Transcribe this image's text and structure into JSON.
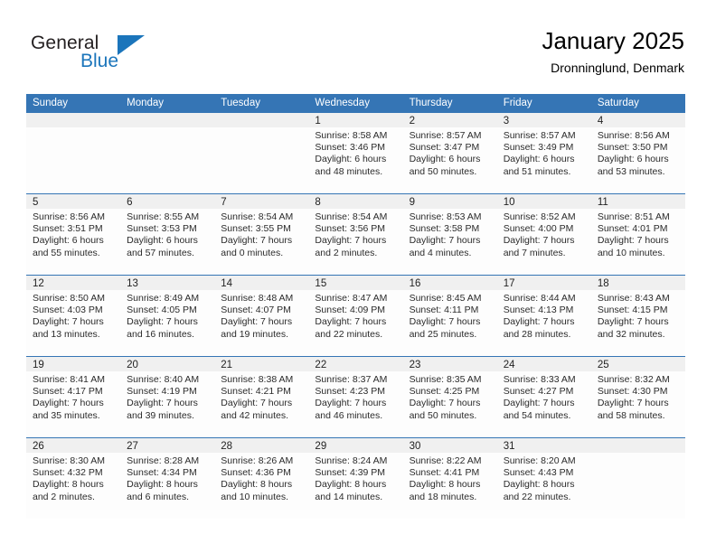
{
  "brand": {
    "name_part1": "General",
    "name_part2": "Blue",
    "flag_icon": "triangle-flag-icon",
    "accent_color": "#1b75bb"
  },
  "header": {
    "title": "January 2025",
    "location": "Dronninglund, Denmark"
  },
  "theme": {
    "header_blue": "#3575b5",
    "daynum_band": "#f0f0f0",
    "page_background": "#ffffff"
  },
  "weekday_headers": [
    "Sunday",
    "Monday",
    "Tuesday",
    "Wednesday",
    "Thursday",
    "Friday",
    "Saturday"
  ],
  "weeks": [
    [
      {
        "day": "",
        "sunrise": "",
        "sunset": "",
        "daylight_line1": "",
        "daylight_line2": ""
      },
      {
        "day": "",
        "sunrise": "",
        "sunset": "",
        "daylight_line1": "",
        "daylight_line2": ""
      },
      {
        "day": "",
        "sunrise": "",
        "sunset": "",
        "daylight_line1": "",
        "daylight_line2": ""
      },
      {
        "day": "1",
        "sunrise": "Sunrise: 8:58 AM",
        "sunset": "Sunset: 3:46 PM",
        "daylight_line1": "Daylight: 6 hours",
        "daylight_line2": "and 48 minutes."
      },
      {
        "day": "2",
        "sunrise": "Sunrise: 8:57 AM",
        "sunset": "Sunset: 3:47 PM",
        "daylight_line1": "Daylight: 6 hours",
        "daylight_line2": "and 50 minutes."
      },
      {
        "day": "3",
        "sunrise": "Sunrise: 8:57 AM",
        "sunset": "Sunset: 3:49 PM",
        "daylight_line1": "Daylight: 6 hours",
        "daylight_line2": "and 51 minutes."
      },
      {
        "day": "4",
        "sunrise": "Sunrise: 8:56 AM",
        "sunset": "Sunset: 3:50 PM",
        "daylight_line1": "Daylight: 6 hours",
        "daylight_line2": "and 53 minutes."
      }
    ],
    [
      {
        "day": "5",
        "sunrise": "Sunrise: 8:56 AM",
        "sunset": "Sunset: 3:51 PM",
        "daylight_line1": "Daylight: 6 hours",
        "daylight_line2": "and 55 minutes."
      },
      {
        "day": "6",
        "sunrise": "Sunrise: 8:55 AM",
        "sunset": "Sunset: 3:53 PM",
        "daylight_line1": "Daylight: 6 hours",
        "daylight_line2": "and 57 minutes."
      },
      {
        "day": "7",
        "sunrise": "Sunrise: 8:54 AM",
        "sunset": "Sunset: 3:55 PM",
        "daylight_line1": "Daylight: 7 hours",
        "daylight_line2": "and 0 minutes."
      },
      {
        "day": "8",
        "sunrise": "Sunrise: 8:54 AM",
        "sunset": "Sunset: 3:56 PM",
        "daylight_line1": "Daylight: 7 hours",
        "daylight_line2": "and 2 minutes."
      },
      {
        "day": "9",
        "sunrise": "Sunrise: 8:53 AM",
        "sunset": "Sunset: 3:58 PM",
        "daylight_line1": "Daylight: 7 hours",
        "daylight_line2": "and 4 minutes."
      },
      {
        "day": "10",
        "sunrise": "Sunrise: 8:52 AM",
        "sunset": "Sunset: 4:00 PM",
        "daylight_line1": "Daylight: 7 hours",
        "daylight_line2": "and 7 minutes."
      },
      {
        "day": "11",
        "sunrise": "Sunrise: 8:51 AM",
        "sunset": "Sunset: 4:01 PM",
        "daylight_line1": "Daylight: 7 hours",
        "daylight_line2": "and 10 minutes."
      }
    ],
    [
      {
        "day": "12",
        "sunrise": "Sunrise: 8:50 AM",
        "sunset": "Sunset: 4:03 PM",
        "daylight_line1": "Daylight: 7 hours",
        "daylight_line2": "and 13 minutes."
      },
      {
        "day": "13",
        "sunrise": "Sunrise: 8:49 AM",
        "sunset": "Sunset: 4:05 PM",
        "daylight_line1": "Daylight: 7 hours",
        "daylight_line2": "and 16 minutes."
      },
      {
        "day": "14",
        "sunrise": "Sunrise: 8:48 AM",
        "sunset": "Sunset: 4:07 PM",
        "daylight_line1": "Daylight: 7 hours",
        "daylight_line2": "and 19 minutes."
      },
      {
        "day": "15",
        "sunrise": "Sunrise: 8:47 AM",
        "sunset": "Sunset: 4:09 PM",
        "daylight_line1": "Daylight: 7 hours",
        "daylight_line2": "and 22 minutes."
      },
      {
        "day": "16",
        "sunrise": "Sunrise: 8:45 AM",
        "sunset": "Sunset: 4:11 PM",
        "daylight_line1": "Daylight: 7 hours",
        "daylight_line2": "and 25 minutes."
      },
      {
        "day": "17",
        "sunrise": "Sunrise: 8:44 AM",
        "sunset": "Sunset: 4:13 PM",
        "daylight_line1": "Daylight: 7 hours",
        "daylight_line2": "and 28 minutes."
      },
      {
        "day": "18",
        "sunrise": "Sunrise: 8:43 AM",
        "sunset": "Sunset: 4:15 PM",
        "daylight_line1": "Daylight: 7 hours",
        "daylight_line2": "and 32 minutes."
      }
    ],
    [
      {
        "day": "19",
        "sunrise": "Sunrise: 8:41 AM",
        "sunset": "Sunset: 4:17 PM",
        "daylight_line1": "Daylight: 7 hours",
        "daylight_line2": "and 35 minutes."
      },
      {
        "day": "20",
        "sunrise": "Sunrise: 8:40 AM",
        "sunset": "Sunset: 4:19 PM",
        "daylight_line1": "Daylight: 7 hours",
        "daylight_line2": "and 39 minutes."
      },
      {
        "day": "21",
        "sunrise": "Sunrise: 8:38 AM",
        "sunset": "Sunset: 4:21 PM",
        "daylight_line1": "Daylight: 7 hours",
        "daylight_line2": "and 42 minutes."
      },
      {
        "day": "22",
        "sunrise": "Sunrise: 8:37 AM",
        "sunset": "Sunset: 4:23 PM",
        "daylight_line1": "Daylight: 7 hours",
        "daylight_line2": "and 46 minutes."
      },
      {
        "day": "23",
        "sunrise": "Sunrise: 8:35 AM",
        "sunset": "Sunset: 4:25 PM",
        "daylight_line1": "Daylight: 7 hours",
        "daylight_line2": "and 50 minutes."
      },
      {
        "day": "24",
        "sunrise": "Sunrise: 8:33 AM",
        "sunset": "Sunset: 4:27 PM",
        "daylight_line1": "Daylight: 7 hours",
        "daylight_line2": "and 54 minutes."
      },
      {
        "day": "25",
        "sunrise": "Sunrise: 8:32 AM",
        "sunset": "Sunset: 4:30 PM",
        "daylight_line1": "Daylight: 7 hours",
        "daylight_line2": "and 58 minutes."
      }
    ],
    [
      {
        "day": "26",
        "sunrise": "Sunrise: 8:30 AM",
        "sunset": "Sunset: 4:32 PM",
        "daylight_line1": "Daylight: 8 hours",
        "daylight_line2": "and 2 minutes."
      },
      {
        "day": "27",
        "sunrise": "Sunrise: 8:28 AM",
        "sunset": "Sunset: 4:34 PM",
        "daylight_line1": "Daylight: 8 hours",
        "daylight_line2": "and 6 minutes."
      },
      {
        "day": "28",
        "sunrise": "Sunrise: 8:26 AM",
        "sunset": "Sunset: 4:36 PM",
        "daylight_line1": "Daylight: 8 hours",
        "daylight_line2": "and 10 minutes."
      },
      {
        "day": "29",
        "sunrise": "Sunrise: 8:24 AM",
        "sunset": "Sunset: 4:39 PM",
        "daylight_line1": "Daylight: 8 hours",
        "daylight_line2": "and 14 minutes."
      },
      {
        "day": "30",
        "sunrise": "Sunrise: 8:22 AM",
        "sunset": "Sunset: 4:41 PM",
        "daylight_line1": "Daylight: 8 hours",
        "daylight_line2": "and 18 minutes."
      },
      {
        "day": "31",
        "sunrise": "Sunrise: 8:20 AM",
        "sunset": "Sunset: 4:43 PM",
        "daylight_line1": "Daylight: 8 hours",
        "daylight_line2": "and 22 minutes."
      },
      {
        "day": "",
        "sunrise": "",
        "sunset": "",
        "daylight_line1": "",
        "daylight_line2": ""
      }
    ]
  ]
}
